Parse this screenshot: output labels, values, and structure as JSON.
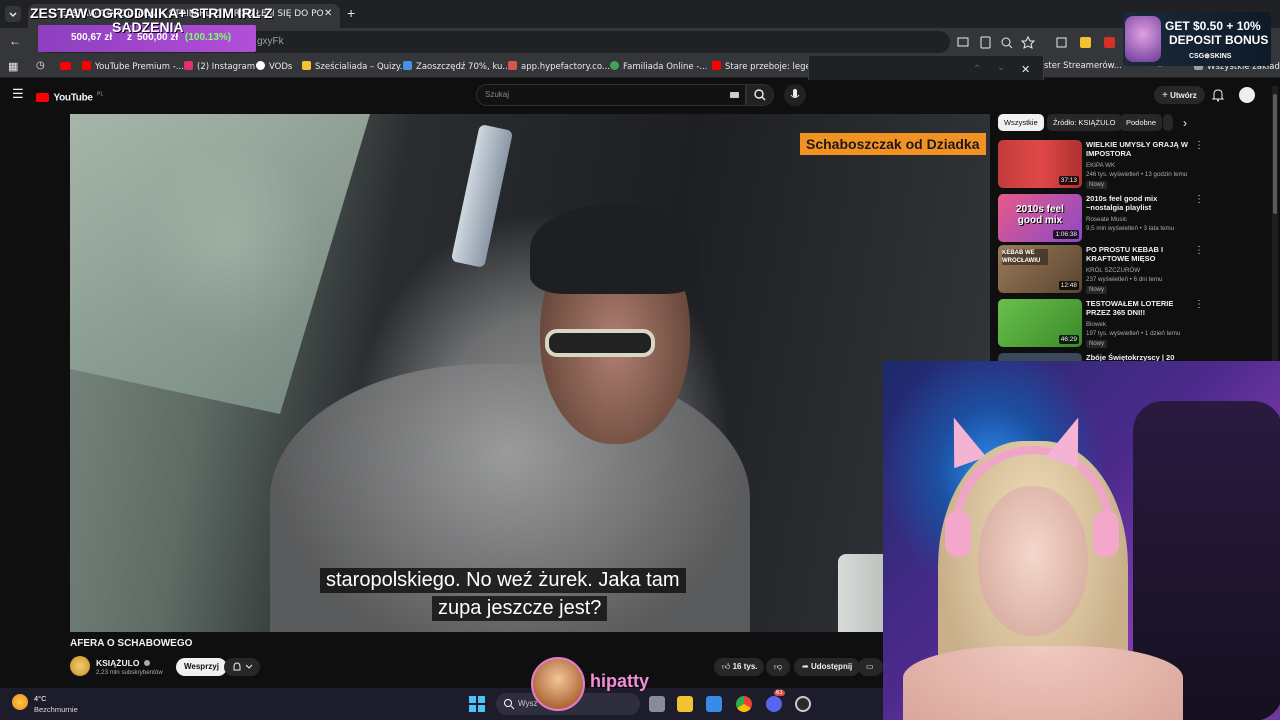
{
  "browser": {
    "tab_title": "ZESTAW OGRODNIKA + STRIMIRL Z ... ROBIŁEM SIĘ DO PO",
    "url_fragment": "gxyFk",
    "bookmarks": [
      {
        "label": "YouTube Premium -...",
        "color": "#ff0000"
      },
      {
        "label": "(2) Instagram",
        "color": "#e1306c"
      },
      {
        "label": "VODs",
        "color": "#ffffff"
      },
      {
        "label": "Sześcialiada – Quizy...",
        "color": "#f2c230"
      },
      {
        "label": "Zaoszczędź 70%, ku...",
        "color": "#4a90e2"
      },
      {
        "label": "app.hypefactory.co...",
        "color": "#d9534f"
      },
      {
        "label": "Familiada Online -...",
        "color": "#3fa55a"
      },
      {
        "label": "Stare przeboje: lege...",
        "color": "#ff0000"
      },
      {
        "label": "ster Streamerów...",
        "color": "#888888"
      }
    ],
    "all_bookmarks": "Wszystkie zakładki"
  },
  "youtube": {
    "logo_text": "YouTube",
    "region": "PL",
    "search_placeholder": "Szukaj",
    "create_label": "Utwórz",
    "chips": [
      "Wszystkie",
      "Źródło: KSIĄŻULO",
      "Podobne"
    ],
    "video": {
      "overlay_label": "Schaboszczak od Dziadka",
      "subtitle_line1": "staropolskiego. No weź żurek. Jaka tam",
      "subtitle_line2": "zupa jeszcze jest?",
      "title": "AFERA O SCHABOWEGO",
      "channel": "KSIĄŻULO",
      "subscribers": "2,23 mln subskrybentów",
      "support_label": "Wesprzyj",
      "likes": "16 tys.",
      "share_label": "Udostępnij"
    },
    "recommendations": [
      {
        "title": "WIELKIE UMYSŁY GRAJĄ W IMPOSTORA",
        "channel": "EKIPA WK",
        "meta": "246 tys. wyświetleń • 13 godzin temu",
        "duration": "37:13",
        "badge": "Nowy",
        "thumb_color": "#c23b3b"
      },
      {
        "title": "2010s feel good mix ~nostalgia playlist",
        "channel": "Roseate Music",
        "meta": "9,5 mln wyświetleń • 3 lata temu",
        "duration": "1:06:38",
        "badge": "",
        "thumb_color": "#e85a8a",
        "thumb_text": "2010s feel good mix"
      },
      {
        "title": "PO PROSTU KEBAB I KRAFTOWE MIĘSO",
        "channel": "KRÓL SZCZURÓW",
        "meta": "237 wyświetleń • 6 dni temu",
        "duration": "12:48",
        "badge": "Nowy",
        "thumb_color": "#7a5a3a",
        "thumb_text": "KEBAB WE WROCŁAWIU"
      },
      {
        "title": "TESTOWAŁEM LOTERIE PRZEZ 365 DNI!!",
        "channel": "Blowek",
        "meta": "197 tys. wyświetleń • 1 dzień temu",
        "duration": "46:29",
        "badge": "Nowy",
        "thumb_color": "#5aa83a"
      },
      {
        "title": "Zbóje Świętokrzyscy | 20",
        "channel": "",
        "meta": "",
        "duration": "",
        "badge": "",
        "thumb_color": "#3a4a5a"
      }
    ]
  },
  "overlay": {
    "goal_title": "ZESTAW OGRODNIKA+ STRIM IRL Z",
    "goal_title2": "SADZENIA",
    "goal_progress": "500,67 zł",
    "goal_sep": "z",
    "goal_target": "500,00 zł",
    "goal_percent": "(100.13%)",
    "goal_fraction": 1.0,
    "ad_line1": "GET $0.50 + 10%",
    "ad_line2": "DEPOSIT BONUS",
    "ad_brand": "CSG⊕SKINS",
    "streamer_name": "hipatty"
  },
  "taskbar": {
    "temperature": "4°C",
    "weather": "Bezchmurnie",
    "search_placeholder": "Wysz",
    "discord_badge": "61"
  }
}
